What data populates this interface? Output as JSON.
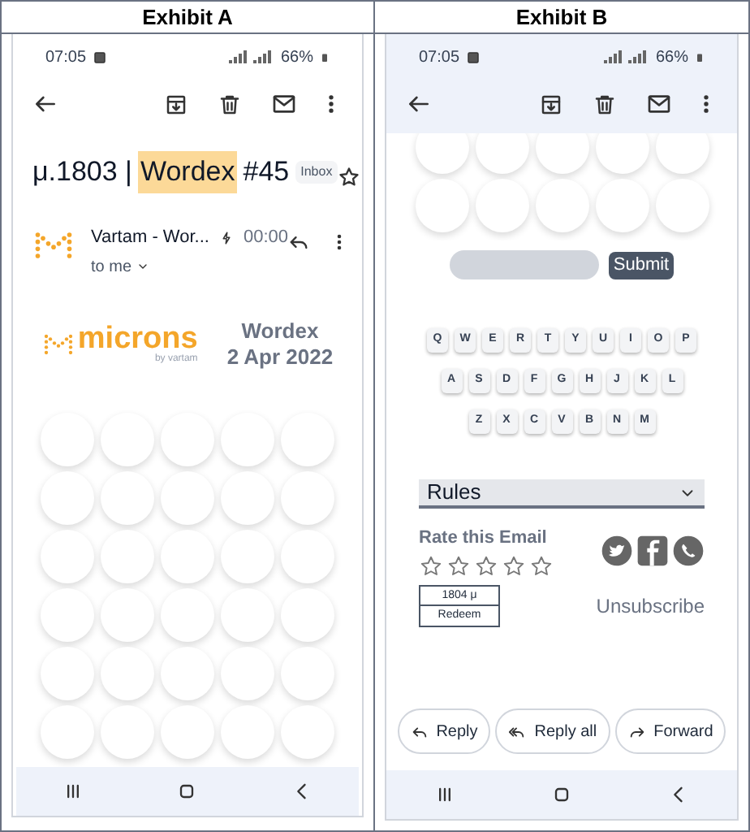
{
  "exhibit_a": {
    "title": "Exhibit A",
    "status_bar": {
      "time": "07:05",
      "battery": "66%"
    },
    "subject": [
      {
        "text": "μ.1803 |",
        "highlighted": false
      },
      {
        "text": "Wordex",
        "highlighted": true
      },
      {
        "text": "#45",
        "highlighted": false
      }
    ],
    "label": "Inbox",
    "starred": false,
    "sender": {
      "name": "Vartam - Wor...",
      "time": "00:00",
      "recipient": "to me"
    },
    "banner": {
      "brand": "microns",
      "tagline": "by vartam",
      "heading": "Wordex",
      "date": "2 Apr 2022"
    }
  },
  "exhibit_b": {
    "title": "Exhibit B",
    "status_bar": {
      "time": "07:05",
      "battery": "66%"
    },
    "submit": "Submit",
    "keyboard": [
      [
        "Q",
        "W",
        "E",
        "R",
        "T",
        "Y",
        "U",
        "I",
        "O",
        "P"
      ],
      [
        "A",
        "S",
        "D",
        "F",
        "G",
        "H",
        "J",
        "K",
        "L"
      ],
      [
        "Z",
        "X",
        "C",
        "V",
        "B",
        "N",
        "M"
      ]
    ],
    "rules": {
      "label": "Rules",
      "expanded": false
    },
    "rating": {
      "title": "Rate this Email",
      "stars": 0
    },
    "reward": {
      "amount": "1804 μ",
      "action": "Redeem"
    },
    "unsubscribe": "Unsubscribe",
    "actions": [
      "Reply",
      "Reply all",
      "Forward"
    ]
  }
}
